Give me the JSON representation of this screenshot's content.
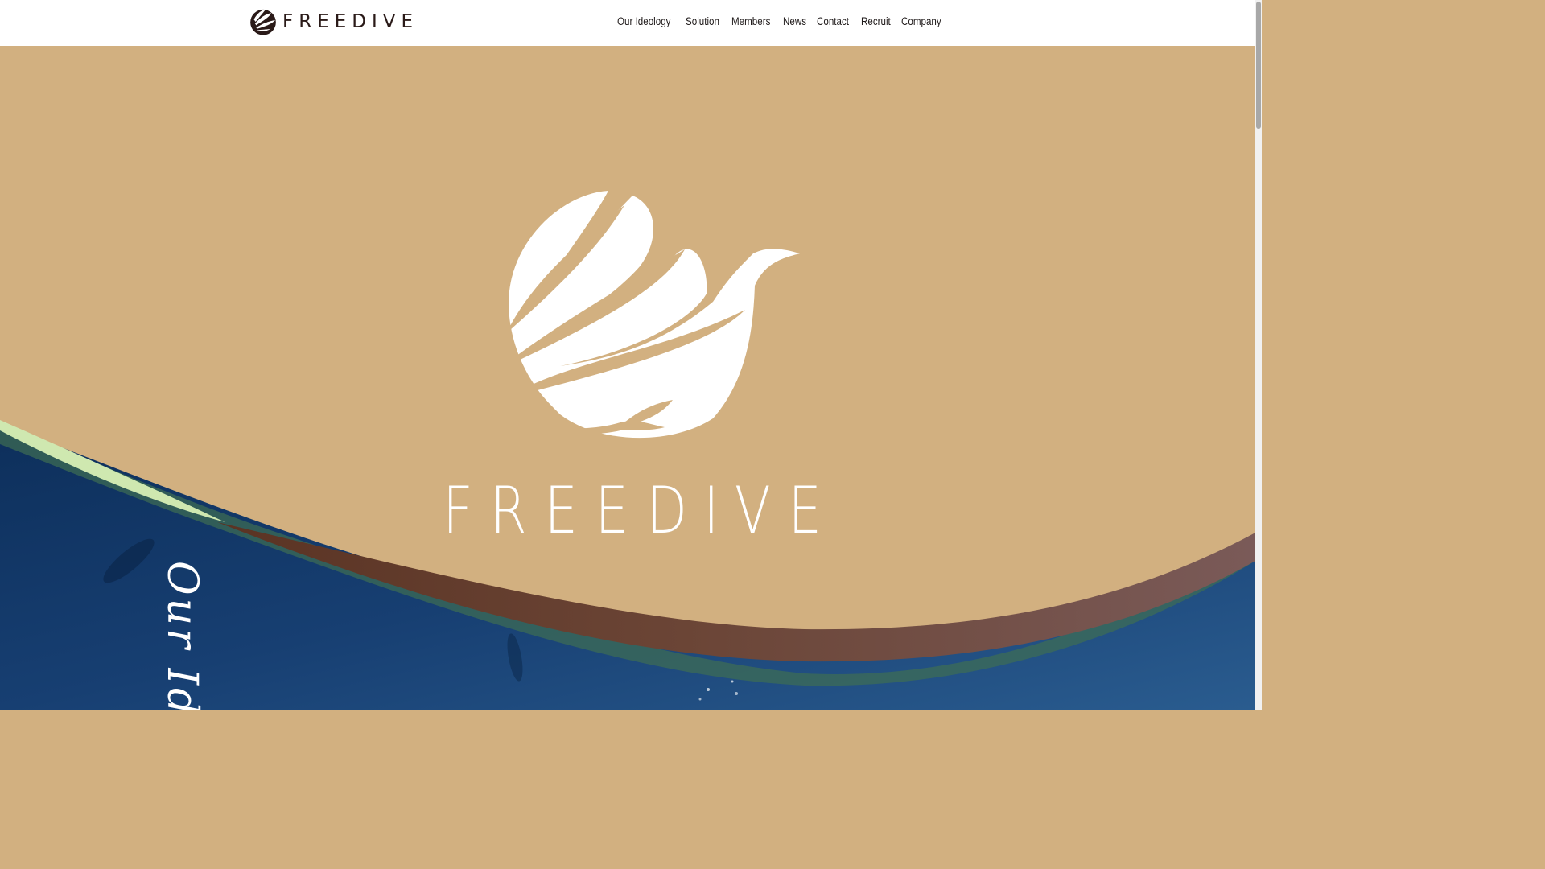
{
  "header": {
    "logo_text": "FREEDIVE",
    "nav": [
      "Our Ideology",
      "Solution",
      "Members",
      "News",
      "Contact",
      "Recruit",
      "Company"
    ]
  },
  "hero": {
    "brand_word": [
      "F",
      "R",
      "E",
      "E",
      "D",
      "I",
      "V",
      "E"
    ],
    "vertical_title": "Our Ideology"
  },
  "colors": {
    "sand": "#d2b080",
    "ocean_dark": "#0d2f5b",
    "ocean_mid": "#234d7f",
    "wave_green": "#cfe8b0",
    "wave_brown": "#6b4536",
    "text_dark": "#1f1a1a"
  },
  "icons": [
    "freedive-logo-icon"
  ]
}
